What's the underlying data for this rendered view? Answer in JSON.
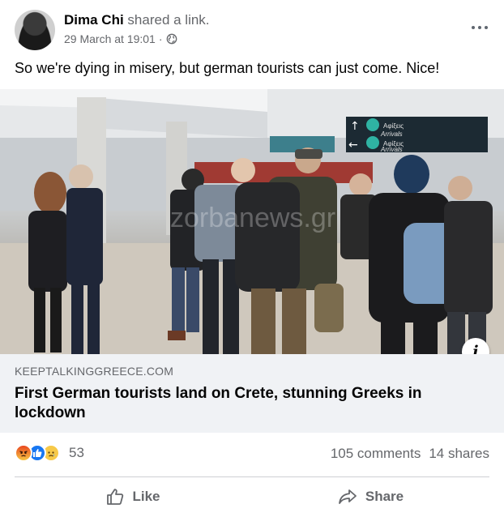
{
  "post": {
    "author": "Dima Chi",
    "action": "shared a link.",
    "timestamp": "29 March at 19:01",
    "separator": "·",
    "privacy_icon": "globe-icon",
    "more_icon": "more-options-icon",
    "text": "So we're dying in misery, but german tourists can just come. Nice!"
  },
  "link": {
    "domain": "KEEPTALKINGGREECE.COM",
    "title": "First German tourists land on Crete, stunning Greeks in lockdown",
    "image_alt": "Travellers wearing masks waiting in an airport arrivals hall",
    "watermark": "zorbanews.gr",
    "sign_arrivals": "Arrivals",
    "sign_greek": "Αφίξεις",
    "info_label": "i"
  },
  "stats": {
    "reaction_icons": [
      "angry-reaction-icon",
      "like-reaction-icon",
      "sad-reaction-icon"
    ],
    "reaction_count": "53",
    "comments": "105 comments",
    "shares": "14 shares"
  },
  "actions": {
    "like_label": "Like",
    "share_label": "Share"
  },
  "colors": {
    "accent": "#1877f2",
    "secondary_text": "#65676b",
    "card_background": "#f0f2f5",
    "sign_background": "#1c2a33"
  }
}
